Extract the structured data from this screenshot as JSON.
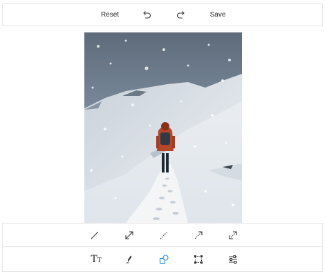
{
  "toolbar": {
    "reset_label": "Reset",
    "undo_icon": "undo-icon",
    "redo_icon": "redo-icon",
    "save_label": "Save"
  },
  "canvas": {
    "image_subject": "hiker-on-snowy-mountain-ridge"
  },
  "line_tools": [
    {
      "name": "line-icon"
    },
    {
      "name": "double-arrow-icon"
    },
    {
      "name": "dashed-line-icon"
    },
    {
      "name": "dashed-arrow-icon"
    },
    {
      "name": "dashed-double-arrow-icon"
    }
  ],
  "main_tools": {
    "text_tool_label_big": "T",
    "text_tool_label_small": "T",
    "active_tool": "shapes",
    "accent_color": "#1e88e5"
  }
}
